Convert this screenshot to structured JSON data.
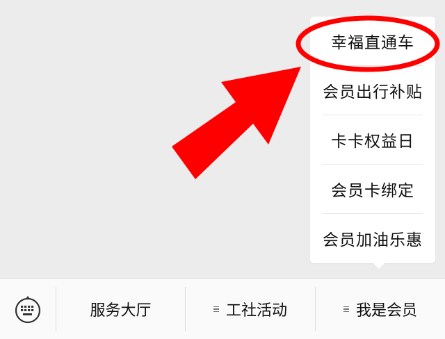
{
  "submenu": {
    "items": [
      {
        "label": "幸福直通车"
      },
      {
        "label": "会员出行补贴"
      },
      {
        "label": "卡卡权益日"
      },
      {
        "label": "会员卡绑定"
      },
      {
        "label": "会员加油乐惠"
      }
    ]
  },
  "tabbar": {
    "keyboard_icon": "keyboard-icon",
    "tabs": [
      {
        "label": "服务大厅",
        "has_submenu": false
      },
      {
        "label": "工社活动",
        "has_submenu": true
      },
      {
        "label": "我是会员",
        "has_submenu": true
      }
    ]
  },
  "annotation": {
    "color": "#ff0000",
    "highlighted_item": "幸福直通车"
  }
}
